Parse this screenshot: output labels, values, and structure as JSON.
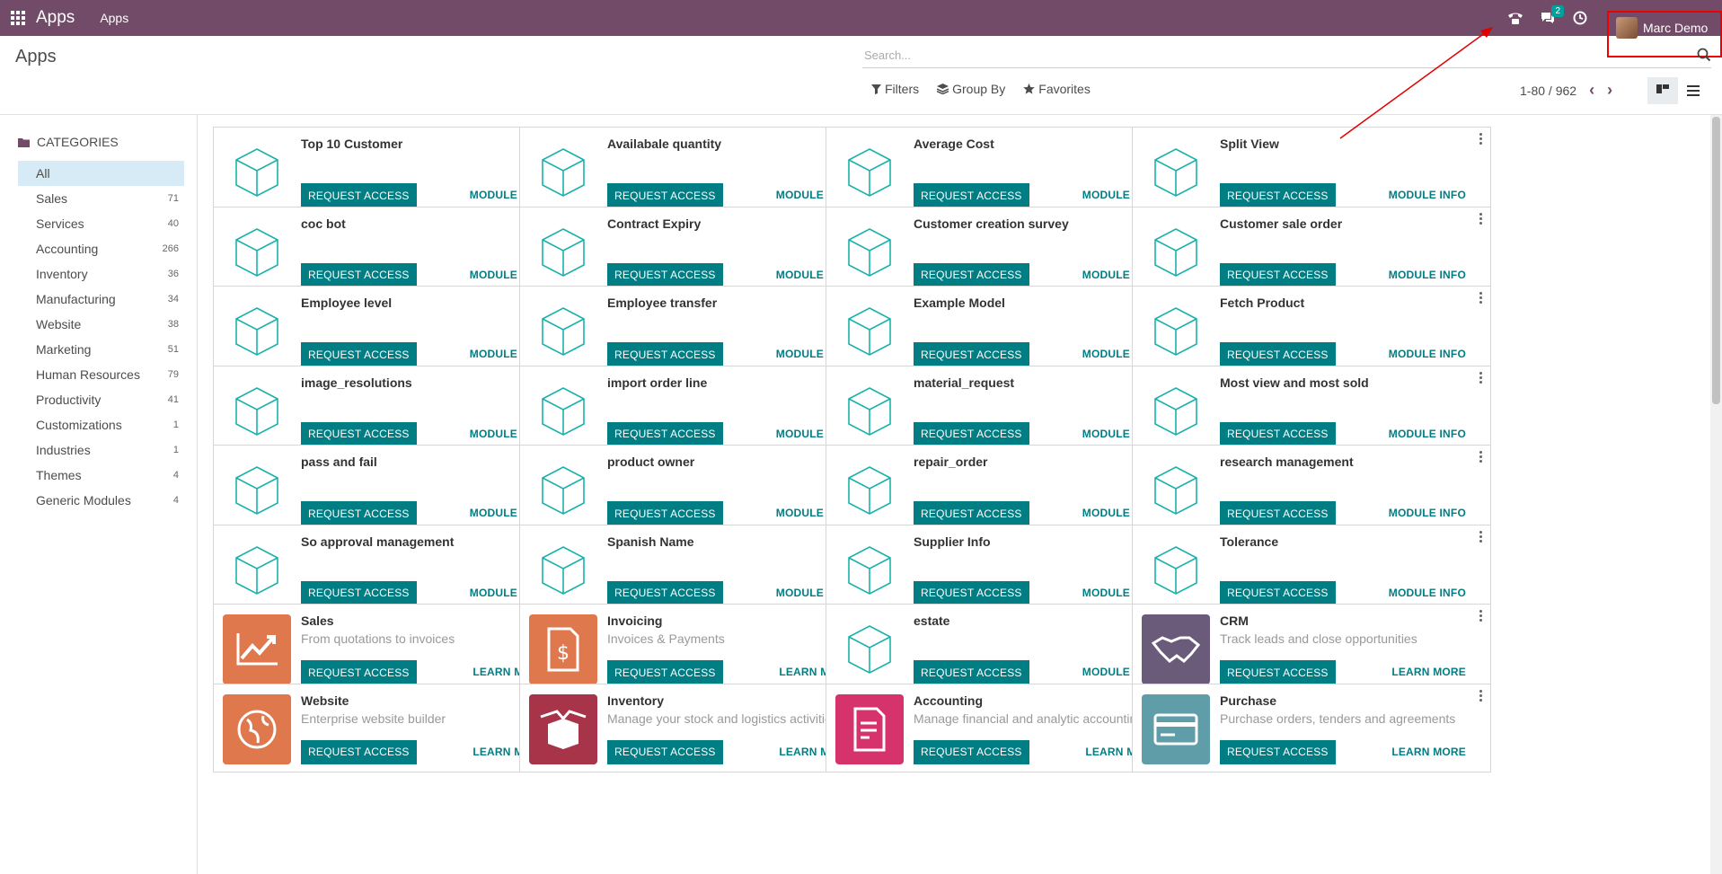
{
  "navbar": {
    "brand": "Apps",
    "menu_item": "Apps",
    "messages_badge": "2",
    "user_name": "Marc Demo"
  },
  "control_panel": {
    "title": "Apps",
    "search_placeholder": "Search...",
    "filters_label": "Filters",
    "group_by_label": "Group By",
    "favorites_label": "Favorites",
    "pager_value": "1-80 / 962"
  },
  "sidebar": {
    "header": "CATEGORIES",
    "items": [
      {
        "label": "All",
        "count": ""
      },
      {
        "label": "Sales",
        "count": "71"
      },
      {
        "label": "Services",
        "count": "40"
      },
      {
        "label": "Accounting",
        "count": "266"
      },
      {
        "label": "Inventory",
        "count": "36"
      },
      {
        "label": "Manufacturing",
        "count": "34"
      },
      {
        "label": "Website",
        "count": "38"
      },
      {
        "label": "Marketing",
        "count": "51"
      },
      {
        "label": "Human Resources",
        "count": "79"
      },
      {
        "label": "Productivity",
        "count": "41"
      },
      {
        "label": "Customizations",
        "count": "1"
      },
      {
        "label": "Industries",
        "count": "1"
      },
      {
        "label": "Themes",
        "count": "4"
      },
      {
        "label": "Generic Modules",
        "count": "4"
      }
    ]
  },
  "cards": [
    {
      "title": "Top 10 Customer",
      "summary": "",
      "button": "REQUEST ACCESS",
      "link": "MODULE INFO",
      "icon": "cube-icon"
    },
    {
      "title": "Availabale quantity",
      "summary": "",
      "button": "REQUEST ACCESS",
      "link": "MODULE INFO",
      "icon": "cube-icon"
    },
    {
      "title": "Average Cost",
      "summary": "",
      "button": "REQUEST ACCESS",
      "link": "MODULE INFO",
      "icon": "cube-icon"
    },
    {
      "title": "Split View",
      "summary": "",
      "button": "REQUEST ACCESS",
      "link": "MODULE INFO",
      "icon": "cube-icon"
    },
    {
      "title": "coc bot",
      "summary": "",
      "button": "REQUEST ACCESS",
      "link": "MODULE INFO",
      "icon": "cube-icon"
    },
    {
      "title": "Contract Expiry",
      "summary": "",
      "button": "REQUEST ACCESS",
      "link": "MODULE INFO",
      "icon": "cube-icon"
    },
    {
      "title": "Customer creation survey",
      "summary": "",
      "button": "REQUEST ACCESS",
      "link": "MODULE INFO",
      "icon": "cube-icon"
    },
    {
      "title": "Customer sale order",
      "summary": "",
      "button": "REQUEST ACCESS",
      "link": "MODULE INFO",
      "icon": "cube-icon"
    },
    {
      "title": "Employee level",
      "summary": "",
      "button": "REQUEST ACCESS",
      "link": "MODULE INFO",
      "icon": "cube-icon"
    },
    {
      "title": "Employee transfer",
      "summary": "",
      "button": "REQUEST ACCESS",
      "link": "MODULE INFO",
      "icon": "cube-icon"
    },
    {
      "title": "Example Model",
      "summary": "",
      "button": "REQUEST ACCESS",
      "link": "MODULE INFO",
      "icon": "cube-icon"
    },
    {
      "title": "Fetch Product",
      "summary": "",
      "button": "REQUEST ACCESS",
      "link": "MODULE INFO",
      "icon": "cube-icon"
    },
    {
      "title": "image_resolutions",
      "summary": "",
      "button": "REQUEST ACCESS",
      "link": "MODULE INFO",
      "icon": "cube-icon"
    },
    {
      "title": "import order line",
      "summary": "",
      "button": "REQUEST ACCESS",
      "link": "MODULE INFO",
      "icon": "cube-icon"
    },
    {
      "title": "material_request",
      "summary": "",
      "button": "REQUEST ACCESS",
      "link": "MODULE INFO",
      "icon": "cube-icon"
    },
    {
      "title": "Most view and most sold",
      "summary": "",
      "button": "REQUEST ACCESS",
      "link": "MODULE INFO",
      "icon": "cube-icon"
    },
    {
      "title": "pass and fail",
      "summary": "",
      "button": "REQUEST ACCESS",
      "link": "MODULE INFO",
      "icon": "cube-icon"
    },
    {
      "title": "product owner",
      "summary": "",
      "button": "REQUEST ACCESS",
      "link": "MODULE INFO",
      "icon": "cube-icon"
    },
    {
      "title": "repair_order",
      "summary": "",
      "button": "REQUEST ACCESS",
      "link": "MODULE INFO",
      "icon": "cube-icon"
    },
    {
      "title": "research management",
      "summary": "",
      "button": "REQUEST ACCESS",
      "link": "MODULE INFO",
      "icon": "cube-icon"
    },
    {
      "title": "So approval management",
      "summary": "",
      "button": "REQUEST ACCESS",
      "link": "MODULE INFO",
      "icon": "cube-icon"
    },
    {
      "title": "Spanish Name",
      "summary": "",
      "button": "REQUEST ACCESS",
      "link": "MODULE INFO",
      "icon": "cube-icon"
    },
    {
      "title": "Supplier Info",
      "summary": "",
      "button": "REQUEST ACCESS",
      "link": "MODULE INFO",
      "icon": "cube-icon"
    },
    {
      "title": "Tolerance",
      "summary": "",
      "button": "REQUEST ACCESS",
      "link": "MODULE INFO",
      "icon": "cube-icon"
    },
    {
      "title": "Sales",
      "summary": "From quotations to invoices",
      "button": "REQUEST ACCESS",
      "link": "LEARN MORE",
      "icon": "sales-chart-icon",
      "color": "#e0784d"
    },
    {
      "title": "Invoicing",
      "summary": "Invoices & Payments",
      "button": "REQUEST ACCESS",
      "link": "LEARN MORE",
      "icon": "invoice-icon",
      "color": "#e0784d"
    },
    {
      "title": "estate",
      "summary": "",
      "button": "REQUEST ACCESS",
      "link": "MODULE INFO",
      "icon": "cube-icon"
    },
    {
      "title": "CRM",
      "summary": "Track leads and close opportunities",
      "button": "REQUEST ACCESS",
      "link": "LEARN MORE",
      "icon": "handshake-icon",
      "color": "#6b5b7b"
    },
    {
      "title": "Website",
      "summary": "Enterprise website builder",
      "button": "REQUEST ACCESS",
      "link": "LEARN MORE",
      "icon": "globe-icon",
      "color": "#e0784d"
    },
    {
      "title": "Inventory",
      "summary": "Manage your stock and logistics activities",
      "button": "REQUEST ACCESS",
      "link": "LEARN MORE",
      "icon": "box-icon",
      "color": "#a8344a"
    },
    {
      "title": "Accounting",
      "summary": "Manage financial and analytic accounting",
      "button": "REQUEST ACCESS",
      "link": "LEARN MORE",
      "icon": "accounting-doc-icon",
      "color": "#d6336c"
    },
    {
      "title": "Purchase",
      "summary": "Purchase orders, tenders and agreements",
      "button": "REQUEST ACCESS",
      "link": "LEARN MORE",
      "icon": "purchase-card-icon",
      "color": "#5f9ea8"
    }
  ],
  "colors": {
    "navbar": "#714b67",
    "primary_button": "#017e84",
    "cube_icon": "#19b2ab",
    "active_category": "#d6ebf5",
    "annotation": "#e00000"
  }
}
